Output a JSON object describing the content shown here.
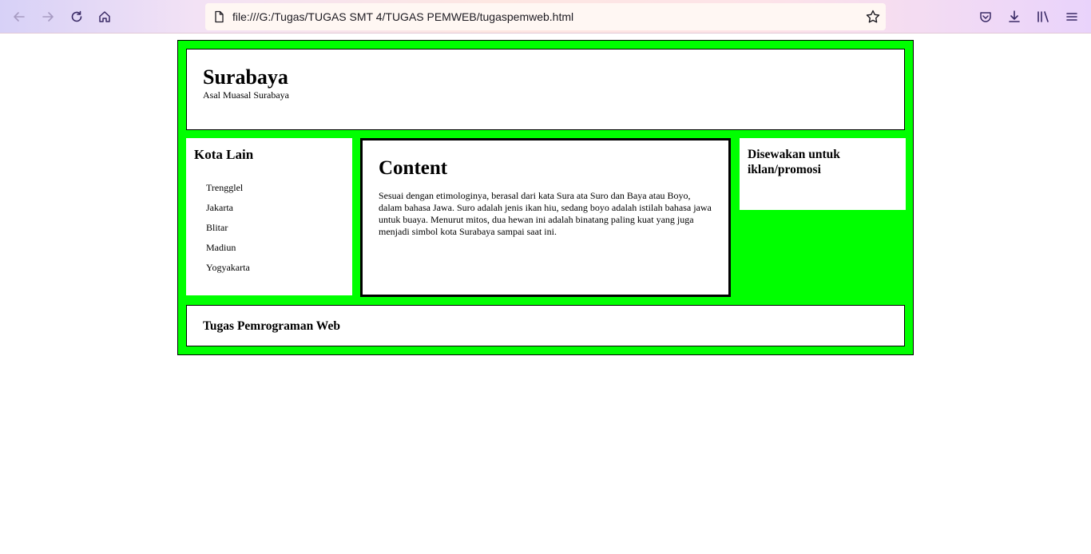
{
  "browser": {
    "url": "file:///G:/Tugas/TUGAS SMT 4/TUGAS PEMWEB/tugaspemweb.html",
    "icons": {
      "back": "back-arrow-icon",
      "forward": "forward-arrow-icon",
      "reload": "reload-icon",
      "home": "home-icon",
      "page": "page-icon",
      "bookmark": "star-icon",
      "pocket": "pocket-icon",
      "downloads": "download-icon",
      "library": "library-icon",
      "menu": "hamburger-menu-icon"
    }
  },
  "header": {
    "title": "Surabaya",
    "subtitle": "Asal Muasal Surabaya"
  },
  "sidebar": {
    "title": "Kota Lain",
    "items": [
      "Trengglel",
      "Jakarta",
      "Blitar",
      "Madiun",
      "Yogyakarta"
    ]
  },
  "content": {
    "title": "Content",
    "text": "Sesuai dengan etimologinya, berasal dari kata Sura ata Suro dan Baya atau Boyo, dalam bahasa Jawa. Suro adalah jenis ikan hiu, sedang boyo adalah istilah bahasa jawa untuk buaya. Menurut mitos, dua hewan ini adalah binatang paling kuat yang juga menjadi simbol kota Surabaya sampai saat ini."
  },
  "ad": {
    "title": "Disewakan untuk iklan/promosi"
  },
  "footer": {
    "text": "Tugas Pemrograman Web"
  },
  "colors": {
    "page_background": "#00ff00",
    "panel_background": "#ffffff",
    "border": "#000000"
  }
}
